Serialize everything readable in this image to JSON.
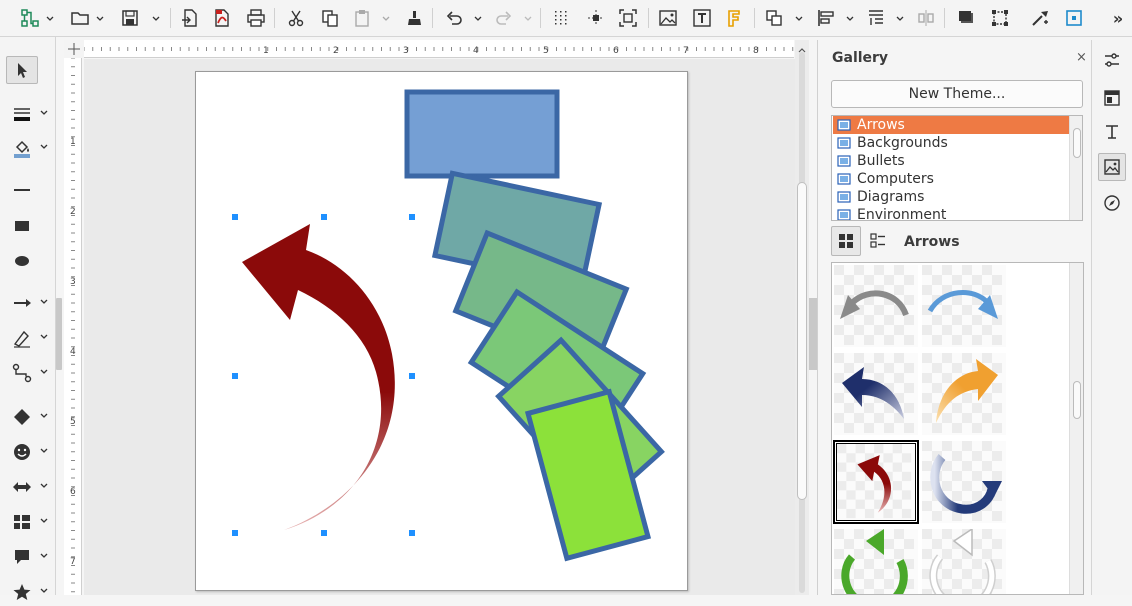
{
  "toolbar": {
    "icons": [
      "connector-icon",
      "open-icon",
      "save-icon",
      "export-icon",
      "export-pdf-icon",
      "print-icon",
      "cut-icon",
      "copy-icon",
      "paste-icon",
      "clone-formatting-icon",
      "undo-icon",
      "redo-icon",
      "grid-icon",
      "helplines-icon",
      "zoom-pan-icon",
      "insert-image-icon",
      "insert-textbox-icon",
      "fontwork-icon",
      "transformations-icon",
      "align-icon",
      "arrange-icon",
      "distribute-icon",
      "shadow-icon",
      "crop-icon",
      "toggle-points-icon",
      "glue-points-icon",
      "more-icon"
    ],
    "overflow_label": "»"
  },
  "left_tools": [
    "select-icon",
    "line-color-icon",
    "fill-color-icon",
    "line-icon",
    "rectangle-icon",
    "ellipse-icon",
    "arrow-line-icon",
    "curve-icon",
    "connector-icon",
    "basic-shapes-icon",
    "symbol-shapes-icon",
    "block-arrows-icon",
    "flowchart-icon",
    "callouts-icon",
    "stars-icon"
  ],
  "ruler": {
    "h_labels": [
      "1",
      "2",
      "3",
      "4",
      "5",
      "6",
      "7",
      "8"
    ],
    "v_labels": [
      "1",
      "2",
      "3",
      "4",
      "5",
      "6",
      "7"
    ]
  },
  "drawing": {
    "arrow_color": "#8b0a0a",
    "rect_stroke": "#3b67a5",
    "rect_fills": [
      "#759fd4",
      "#6fa8a6",
      "#76b889",
      "#7bc878",
      "#88d462",
      "#8ce13a"
    ],
    "handle_color": "#1e90ff"
  },
  "gallery": {
    "title": "Gallery",
    "close_label": "×",
    "new_theme_label": "New Theme...",
    "themes": [
      "Arrows",
      "Backgrounds",
      "Bullets",
      "Computers",
      "Diagrams",
      "Environment"
    ],
    "selected_theme_index": 0,
    "current_theme_heading": "Arrows",
    "items": [
      {
        "name": "gray-curved-arrow-left",
        "color": "#8a8a8a"
      },
      {
        "name": "blue-curved-arrow-right",
        "color": "#5a9ad8"
      },
      {
        "name": "navy-curved-arrow-up-left",
        "color": "#1f2f6b"
      },
      {
        "name": "orange-curved-arrow-up-right",
        "color": "#f0a030"
      },
      {
        "name": "red-curved-arrow-up",
        "color": "#8b0a0a"
      },
      {
        "name": "navy-circular-arrow",
        "color": "#243b7a"
      },
      {
        "name": "green-circular-arrow",
        "color": "#4aa82a"
      },
      {
        "name": "white-circular-arrow",
        "color": "#d8d8d8"
      }
    ],
    "selected_item_index": 4
  },
  "deck": [
    "properties-icon",
    "page-icon",
    "styles-icon",
    "gallery-icon",
    "navigator-icon"
  ]
}
